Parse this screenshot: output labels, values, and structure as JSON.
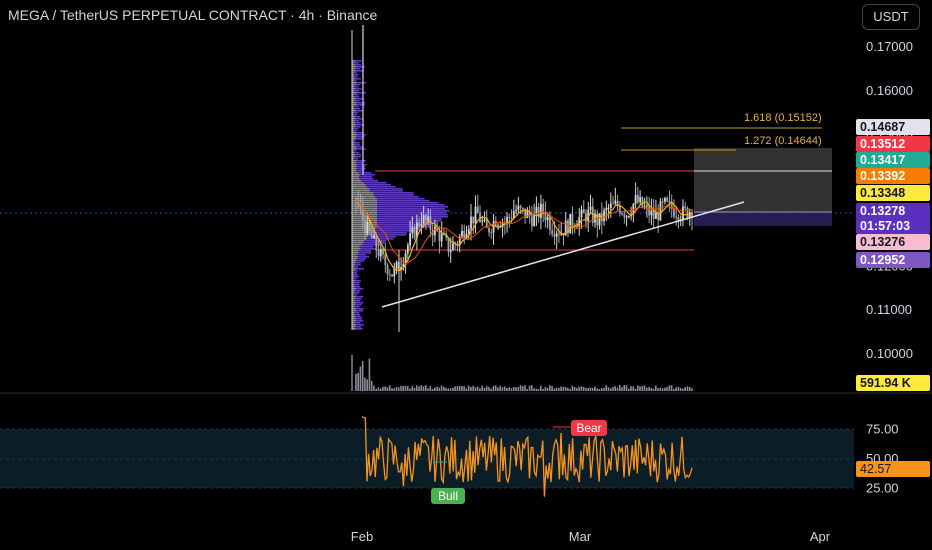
{
  "header": {
    "title": "MEGA / TetherUS PERPETUAL CONTRACT · 4h · Binance",
    "currency": "USDT"
  },
  "chart_data": [
    {
      "type": "candlestick",
      "y_ticks": [
        "0.17000",
        "0.16000",
        "0.15000",
        "0.14000",
        "0.13000",
        "0.12000",
        "0.11000",
        "0.10000"
      ],
      "x_ticks": [
        "Feb",
        "Mar",
        "Apr"
      ],
      "ylim": [
        0.0952,
        0.1778
      ],
      "price_tags": [
        {
          "label": "0.14687",
          "bg": "#e0e3eb",
          "fg": "#131722"
        },
        {
          "label": "0.13512",
          "bg": "#f23645",
          "fg": "#ffffff"
        },
        {
          "label": "0.13417",
          "bg": "#22ab94",
          "fg": "#ffffff"
        },
        {
          "label": "0.13392",
          "bg": "#f57c00",
          "fg": "#ffffff"
        },
        {
          "label": "0.13348",
          "bg": "#ffeb3b",
          "fg": "#131722"
        },
        {
          "label": "0.13278",
          "bg": "#5b2fc0",
          "fg": "#ffffff"
        },
        {
          "label": "0.13276",
          "bg": "#f8bbd0",
          "fg": "#131722"
        },
        {
          "label": "0.12952",
          "bg": "#7e57c2",
          "fg": "#ffffff"
        }
      ],
      "countdown": "01:57:03",
      "fib_levels": [
        {
          "label": "1.618 (0.15152)",
          "value": 0.15152
        },
        {
          "label": "1.272 (0.14644)",
          "value": 0.14644
        }
      ],
      "horizontal_levels": [
        0.13512,
        0.12952
      ],
      "trendline": {
        "from": {
          "x": "Feb 2",
          "y": 0.1125
        },
        "to": {
          "x": "Mar 20",
          "y": 0.128
        }
      },
      "target_box": {
        "top": 0.14687,
        "mid": 0.13392,
        "stop": 0.13,
        "entry": 0.13278
      },
      "approx_close_series": [
        0.1355,
        0.129,
        0.125,
        0.121,
        0.118,
        0.122,
        0.127,
        0.131,
        0.129,
        0.127,
        0.124,
        0.126,
        0.13,
        0.132,
        0.128,
        0.131,
        0.13,
        0.133,
        0.132,
        0.131,
        0.133,
        0.129,
        0.128,
        0.13,
        0.131,
        0.132,
        0.13,
        0.133,
        0.134,
        0.132,
        0.135,
        0.133,
        0.131,
        0.134,
        0.133,
        0.132,
        0.133
      ],
      "volume_label": "591.94 K"
    },
    {
      "type": "line",
      "name": "RSI",
      "y_ticks": [
        "75.00",
        "50.00",
        "25.00"
      ],
      "current_value": "42.57",
      "annotations": [
        "Bull",
        "Bear"
      ],
      "ylim": [
        10,
        95
      ]
    }
  ],
  "colors": {
    "rsi_line": "#f7931a",
    "trendline": "#ffffff",
    "level_line": "#f23645",
    "fib_line": "#b7982a",
    "volume_profile": "#7b4fe0",
    "ma": "#ffb300",
    "rsi_band": "#0f2430"
  }
}
